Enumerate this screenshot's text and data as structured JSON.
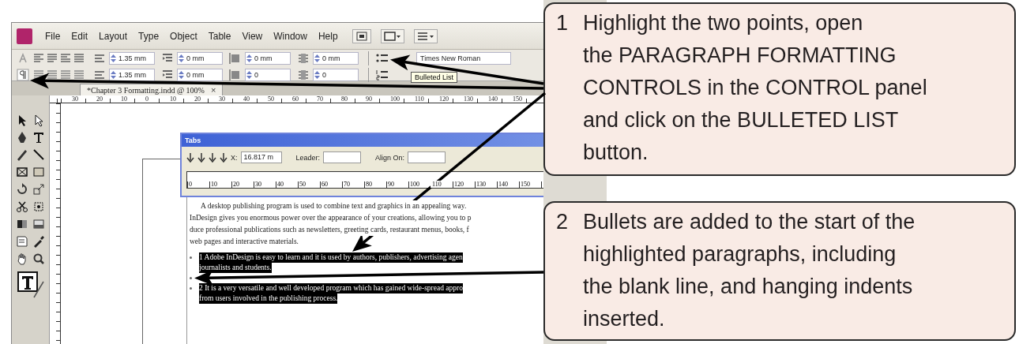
{
  "menu_bar": {
    "items": [
      "File",
      "Edit",
      "Layout",
      "Type",
      "Object",
      "Table",
      "View",
      "Window",
      "Help"
    ]
  },
  "control_panel": {
    "rows": [
      {
        "fields": [
          "1.35 mm",
          "0 mm",
          "0 mm",
          "0 mm"
        ]
      },
      {
        "fields": [
          "1.35 mm",
          "0 mm",
          "0",
          "0"
        ]
      }
    ],
    "font": "Times New Roman",
    "tooltip": "Bulleted List"
  },
  "document_tab": {
    "title": "*Chapter 3 Formatting.indd @ 100%",
    "close": "×"
  },
  "ruler": {
    "labels": [
      "30",
      "20",
      "10",
      "0",
      "10",
      "20",
      "30",
      "40",
      "50",
      "60",
      "70",
      "80",
      "90",
      "100",
      "110",
      "120",
      "130",
      "140",
      "150"
    ]
  },
  "tabs_dialog": {
    "title": "Tabs",
    "x_label": "X:",
    "x_value": "16.817 m",
    "leader_label": "Leader:",
    "align_label": "Align On:",
    "ruler_labels": [
      "0",
      "10",
      "20",
      "30",
      "40",
      "50",
      "60",
      "70",
      "80",
      "90",
      "100",
      "110",
      "120",
      "130",
      "140",
      "150"
    ]
  },
  "document": {
    "intro": [
      "A desktop publishing program is used to combine text and graphics in an appealing way.",
      "InDesign gives you enormous power over the appearance of your creations, allowing you to p",
      "duce professional publications such as newsletters, greeting cards, restaurant menus, books, f",
      "web pages and interactive materials."
    ],
    "points": [
      {
        "lines": [
          "1    Adobe InDesign is easy to learn and it is used by authors, publishers, advertising agen",
          "journalists and students."
        ],
        "selected": true
      },
      {
        "lines": [
          "2    It is a very versatile and well developed program which has gained wide-spread appro",
          "from users involved in the publishing process."
        ],
        "selected": true
      }
    ]
  },
  "callouts": [
    {
      "number": "1",
      "text": "Highlight the two points, open\nthe PARAGRAPH FORMATTING\nCONTROLS in the CONTROL panel\nand click on the BULLETED LIST\nbutton."
    },
    {
      "number": "2",
      "text": "Bullets are added to the start of the\nhighlighted paragraphs, including\nthe blank line, and hanging indents\ninserted."
    }
  ]
}
